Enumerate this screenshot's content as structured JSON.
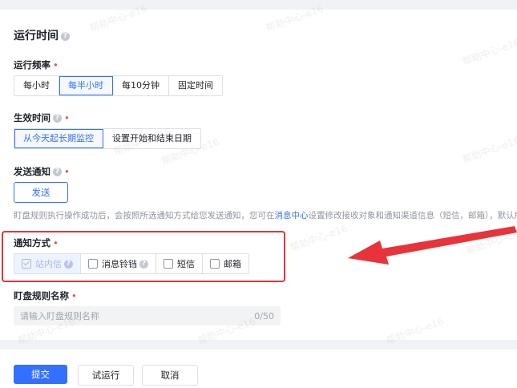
{
  "section": {
    "title": "运行时间"
  },
  "frequency": {
    "label": "运行频率",
    "options": [
      "每小时",
      "每半小时",
      "每10分钟",
      "固定时间"
    ],
    "selected": "每半小时"
  },
  "effective_time": {
    "label": "生效时间",
    "options": [
      "从今天起长期监控",
      "设置开始和结束日期"
    ],
    "selected": "从今天起长期监控"
  },
  "send_notification": {
    "label": "发送通知",
    "button_label": "发送",
    "hint_before": "盯盘规则执行操作成功后，会按照所选通知方式给您发送通知，您可在",
    "hint_link": "消息中心",
    "hint_after": "设置修改接收对象和通知渠道信息（短信，邮箱），默认所有对象可接收。"
  },
  "notify_method": {
    "label": "通知方式",
    "options": [
      {
        "label": "站内信",
        "checked": true,
        "disabled": true,
        "help": true
      },
      {
        "label": "消息铃铛",
        "checked": false,
        "disabled": false,
        "help": true
      },
      {
        "label": "短信",
        "checked": false,
        "disabled": false,
        "help": false
      },
      {
        "label": "邮箱",
        "checked": false,
        "disabled": false,
        "help": false
      }
    ]
  },
  "rule_name": {
    "label": "盯盘规则名称",
    "placeholder": "请输入盯盘规则名称",
    "counter": "0/50"
  },
  "footer": {
    "submit": "提交",
    "trial_run": "试运行",
    "cancel": "取消"
  },
  "watermark": "帮助中心-e16",
  "colors": {
    "primary": "#3370ff",
    "required": "#f54a45",
    "annotation_red": "#e8333a"
  }
}
